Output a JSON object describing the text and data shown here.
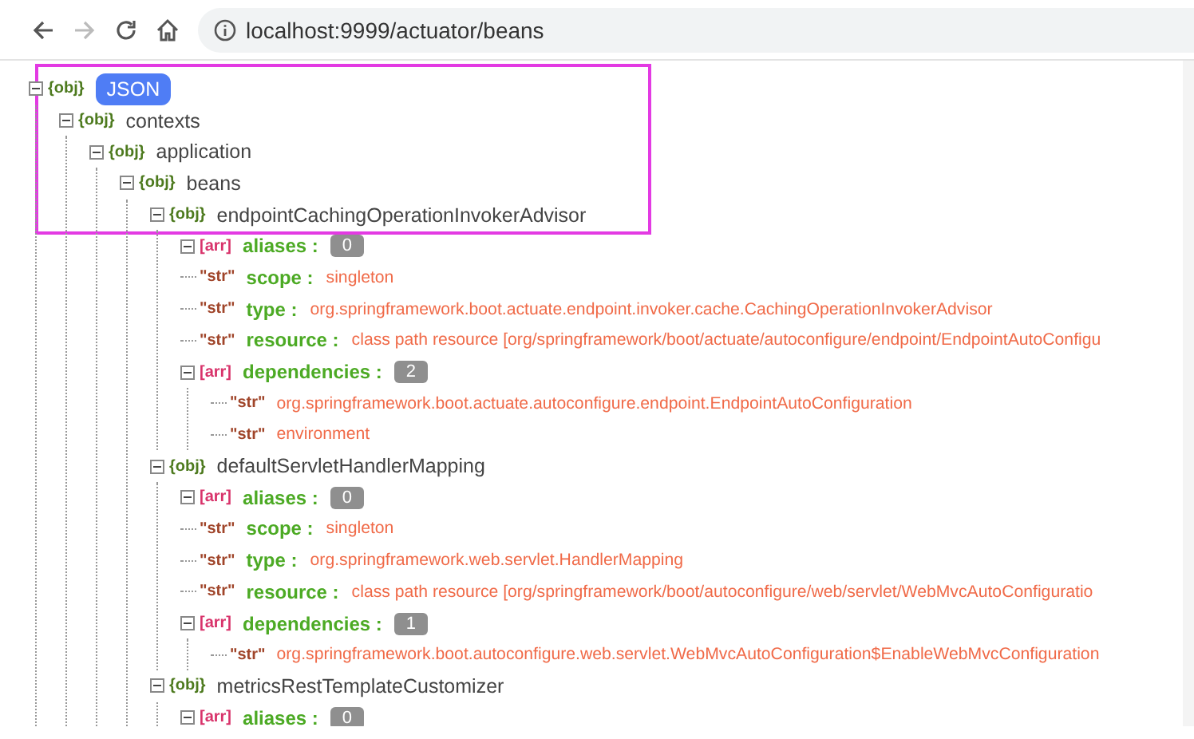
{
  "toolbar": {
    "buttons": [
      {
        "kind": "back",
        "disabled": false
      },
      {
        "kind": "forward",
        "disabled": true
      },
      {
        "kind": "reload",
        "disabled": false
      },
      {
        "kind": "home",
        "disabled": false
      }
    ],
    "url": "localhost:9999/actuator/beans"
  },
  "tree": {
    "kind": "obj",
    "tag": "{obj}",
    "key": "JSON",
    "selected": true,
    "expanded": true,
    "children": [
      {
        "kind": "obj",
        "tag": "{obj}",
        "key": "contexts",
        "selected": false,
        "expanded": true,
        "children": [
          {
            "kind": "obj",
            "tag": "{obj}",
            "key": "application",
            "selected": false,
            "expanded": true,
            "children": [
              {
                "kind": "obj",
                "tag": "{obj}",
                "key": "beans",
                "selected": false,
                "expanded": true,
                "children": [
                  {
                    "kind": "obj",
                    "tag": "{obj}",
                    "key": "endpointCachingOperationInvokerAdvisor",
                    "selected": false,
                    "expanded": true,
                    "children": [
                      {
                        "kind": "arr",
                        "tag": "[arr]",
                        "key": "aliases :",
                        "count": "0",
                        "selected": false,
                        "expanded": true
                      },
                      {
                        "kind": "str",
                        "tag": "\"str\"",
                        "key": "scope :",
                        "value": "singleton",
                        "selected": false
                      },
                      {
                        "kind": "str",
                        "tag": "\"str\"",
                        "key": "type :",
                        "value": "org.springframework.boot.actuate.endpoint.invoker.cache.CachingOperationInvokerAdvisor",
                        "selected": false
                      },
                      {
                        "kind": "str",
                        "tag": "\"str\"",
                        "key": "resource :",
                        "value": "class path resource [org/springframework/boot/actuate/autoconfigure/endpoint/EndpointAutoConfigu",
                        "selected": false
                      },
                      {
                        "kind": "arr",
                        "tag": "[arr]",
                        "key": "dependencies :",
                        "count": "2",
                        "selected": false,
                        "expanded": true,
                        "children": [
                          {
                            "kind": "str",
                            "tag": "\"str\"",
                            "value": "org.springframework.boot.actuate.autoconfigure.endpoint.EndpointAutoConfiguration",
                            "selected": false
                          },
                          {
                            "kind": "str",
                            "tag": "\"str\"",
                            "value": "environment",
                            "selected": false
                          }
                        ]
                      }
                    ]
                  },
                  {
                    "kind": "obj",
                    "tag": "{obj}",
                    "key": "defaultServletHandlerMapping",
                    "selected": false,
                    "expanded": true,
                    "children": [
                      {
                        "kind": "arr",
                        "tag": "[arr]",
                        "key": "aliases :",
                        "count": "0",
                        "selected": false,
                        "expanded": true
                      },
                      {
                        "kind": "str",
                        "tag": "\"str\"",
                        "key": "scope :",
                        "value": "singleton",
                        "selected": false
                      },
                      {
                        "kind": "str",
                        "tag": "\"str\"",
                        "key": "type :",
                        "value": "org.springframework.web.servlet.HandlerMapping",
                        "selected": false
                      },
                      {
                        "kind": "str",
                        "tag": "\"str\"",
                        "key": "resource :",
                        "value": "class path resource [org/springframework/boot/autoconfigure/web/servlet/WebMvcAutoConfiguratio",
                        "selected": false
                      },
                      {
                        "kind": "arr",
                        "tag": "[arr]",
                        "key": "dependencies :",
                        "count": "1",
                        "selected": false,
                        "expanded": true,
                        "children": [
                          {
                            "kind": "str",
                            "tag": "\"str\"",
                            "value": "org.springframework.boot.autoconfigure.web.servlet.WebMvcAutoConfiguration$EnableWebMvcConfiguration",
                            "selected": false
                          }
                        ]
                      }
                    ]
                  },
                  {
                    "kind": "obj",
                    "tag": "{obj}",
                    "key": "metricsRestTemplateCustomizer",
                    "selected": false,
                    "expanded": true,
                    "children": [
                      {
                        "kind": "arr",
                        "tag": "[arr]",
                        "key": "aliases :",
                        "count": "0",
                        "selected": false,
                        "expanded": true
                      }
                    ]
                  }
                ]
              }
            ]
          }
        ]
      }
    ]
  }
}
